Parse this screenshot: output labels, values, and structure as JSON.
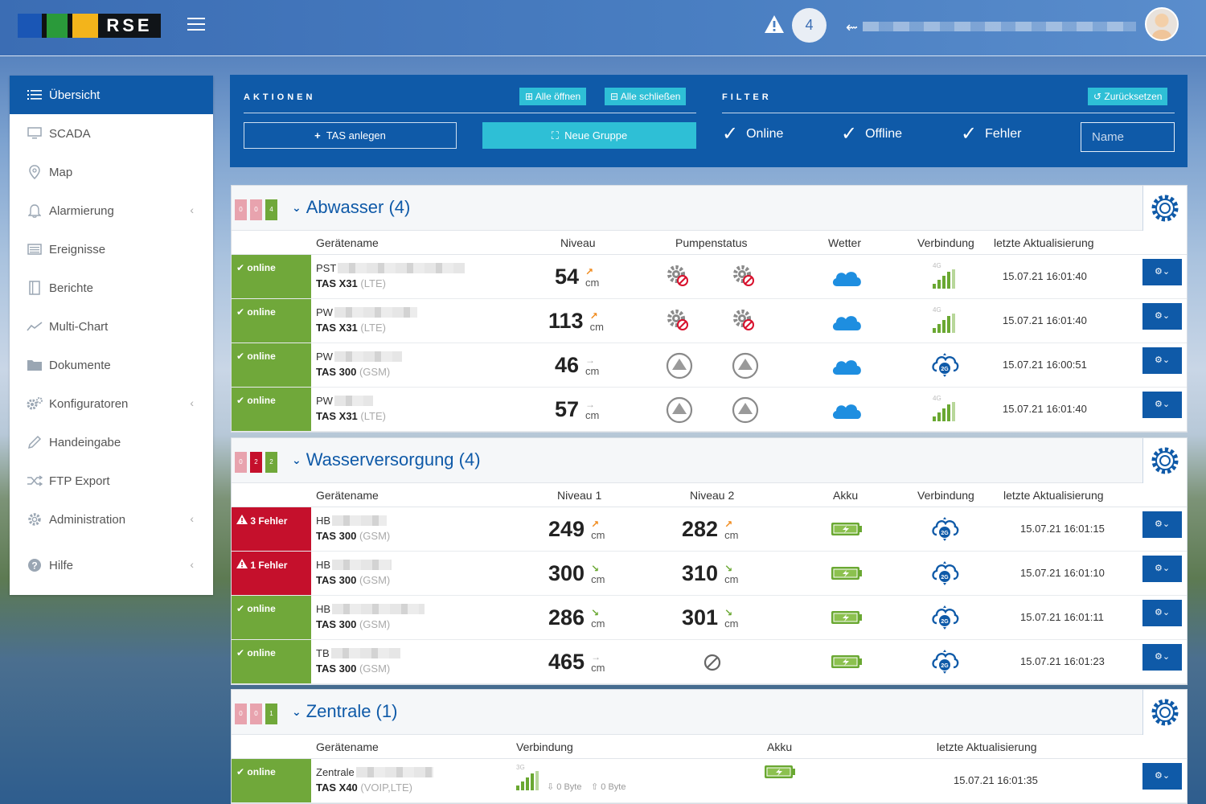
{
  "brand": {
    "logo_text": "RSE",
    "logo_colors": [
      "#1a56b5",
      "#2a9a3a",
      "#f3b41b"
    ]
  },
  "header": {
    "alert_count": "4"
  },
  "sidebar": {
    "items": [
      {
        "label": "Übersicht",
        "icon": "list-icon",
        "active": true
      },
      {
        "label": "SCADA",
        "icon": "monitor-icon"
      },
      {
        "label": "Map",
        "icon": "map-pin-icon"
      },
      {
        "label": "Alarmierung",
        "icon": "bell-icon",
        "has_children": true
      },
      {
        "label": "Ereignisse",
        "icon": "events-icon"
      },
      {
        "label": "Berichte",
        "icon": "report-icon"
      },
      {
        "label": "Multi-Chart",
        "icon": "line-chart-icon"
      },
      {
        "label": "Dokumente",
        "icon": "folder-icon"
      },
      {
        "label": "Konfiguratoren",
        "icon": "gears-icon",
        "has_children": true
      },
      {
        "label": "Handeingabe",
        "icon": "pencil-icon"
      },
      {
        "label": "FTP Export",
        "icon": "shuffle-icon"
      },
      {
        "label": "Administration",
        "icon": "gear-icon",
        "has_children": true
      },
      {
        "label": "Hilfe",
        "icon": "help-icon",
        "has_children": true
      }
    ]
  },
  "actions": {
    "caption": "AKTIONEN",
    "open_all": "Alle öffnen",
    "close_all": "Alle schließen",
    "create_tas": "TAS anlegen",
    "new_group": "Neue Gruppe"
  },
  "filter": {
    "caption": "FILTER",
    "reset": "Zurücksetzen",
    "online": "Online",
    "offline": "Offline",
    "error": "Fehler",
    "name_placeholder": "Name"
  },
  "groups": {
    "abwasser": {
      "title": "Abwasser (4)",
      "badges": [
        "0",
        "0",
        "4"
      ],
      "columns": {
        "name": "Gerätename",
        "c1": "Niveau",
        "c2": "Pumpenstatus",
        "c3": "Wetter",
        "c4": "Verbindung",
        "c5": "letzte Aktualisierung"
      },
      "rows": [
        {
          "status": "online",
          "name": "PST",
          "model": "TAS X31",
          "net": "(LTE)",
          "level": "54",
          "unit": "cm",
          "trend": "↗",
          "pump": "error",
          "conn": "4G",
          "signal": 5,
          "ts": "15.07.21 16:01:40"
        },
        {
          "status": "online",
          "name": "PW",
          "model": "TAS X31",
          "net": "(LTE)",
          "level": "113",
          "unit": "cm",
          "trend": "↗",
          "pump": "error",
          "conn": "4G",
          "signal": 5,
          "ts": "15.07.21 16:01:40"
        },
        {
          "status": "online",
          "name": "PW",
          "model": "TAS 300",
          "net": "(GSM)",
          "level": "46",
          "unit": "cm",
          "trend": "→",
          "pump": "up",
          "conn": "2G",
          "ts": "15.07.21 16:00:51"
        },
        {
          "status": "online",
          "name": "PW",
          "model": "TAS X31",
          "net": "(LTE)",
          "level": "57",
          "unit": "cm",
          "trend": "→",
          "pump": "up",
          "conn": "4G",
          "signal": 5,
          "ts": "15.07.21 16:01:40"
        }
      ]
    },
    "wasser": {
      "title": "Wasserversorgung (4)",
      "badges": [
        "0",
        "2",
        "2"
      ],
      "columns": {
        "name": "Gerätename",
        "c1": "Niveau 1",
        "c2": "Niveau 2",
        "c3": "Akku",
        "c4": "Verbindung",
        "c5": "letzte Aktualisierung"
      },
      "rows": [
        {
          "status": "3 Fehler",
          "name": "HB",
          "model": "TAS 300",
          "net": "(GSM)",
          "level": "249",
          "unit": "cm",
          "trend": "↗",
          "level2": "282",
          "unit2": "cm",
          "trend2": "↗",
          "ts": "15.07.21 16:01:15"
        },
        {
          "status": "1 Fehler",
          "name": "HB",
          "model": "TAS 300",
          "net": "(GSM)",
          "level": "300",
          "unit": "cm",
          "trend": "↘",
          "level2": "310",
          "unit2": "cm",
          "trend2": "↘",
          "ts": "15.07.21 16:01:10"
        },
        {
          "status": "online",
          "name": "HB",
          "model": "TAS 300",
          "net": "(GSM)",
          "level": "286",
          "unit": "cm",
          "trend": "↘",
          "level2": "301",
          "unit2": "cm",
          "trend2": "↘",
          "ts": "15.07.21 16:01:11"
        },
        {
          "status": "online",
          "name": "TB",
          "model": "TAS 300",
          "net": "(GSM)",
          "level": "465",
          "unit": "cm",
          "trend": "→",
          "level2": null,
          "ts": "15.07.21 16:01:23"
        }
      ]
    },
    "zentrale": {
      "title": "Zentrale (1)",
      "badges": [
        "0",
        "0",
        "1"
      ],
      "columns": {
        "name": "Gerätename",
        "c1": "Verbindung",
        "c2": "Akku",
        "c3": "letzte Aktualisierung"
      },
      "rows": [
        {
          "status": "online",
          "name": "Zentrale",
          "model": "TAS X40",
          "net": "(VOIP,LTE)",
          "conn": "3G",
          "up": "0 Byte",
          "down": "0 Byte",
          "ts": "15.07.21 16:01:35"
        }
      ]
    }
  },
  "colors": {
    "primary": "#0f5aa8",
    "cyan": "#2ebfd6",
    "ok": "#70a83a",
    "error": "#c5102c"
  }
}
